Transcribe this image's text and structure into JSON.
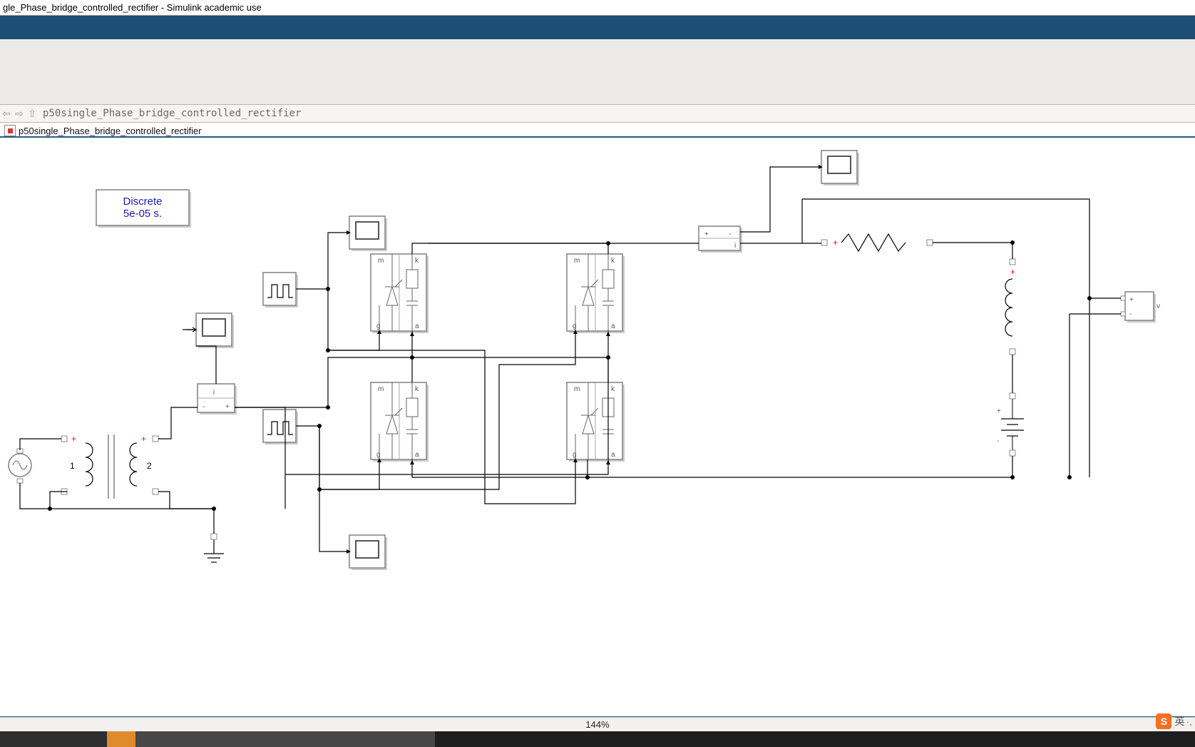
{
  "window": {
    "title": "gle_Phase_bridge_controlled_rectifier - Simulink academic use"
  },
  "nav": {
    "breadcrumb": "p50single_Phase_bridge_controlled_rectifier"
  },
  "tab": {
    "label": "p50single_Phase_bridge_controlled_rectifier"
  },
  "powergui": {
    "line1": "Discrete",
    "line2": "5e-05 s."
  },
  "transformer": {
    "port1": "1",
    "port2": "2"
  },
  "thyristor_terminals": {
    "a": "a",
    "k": "k",
    "g": "g",
    "m": "m"
  },
  "current_meas": {
    "plus": "+",
    "minus": "-",
    "i": "i"
  },
  "voltage_meas": {
    "plus": "+",
    "minus": "-",
    "v": "v"
  },
  "dc_source": {
    "plus": "+",
    "minus": "-"
  },
  "status": {
    "zoom": "144%"
  },
  "ime": {
    "logo": "S",
    "lang": "英"
  }
}
